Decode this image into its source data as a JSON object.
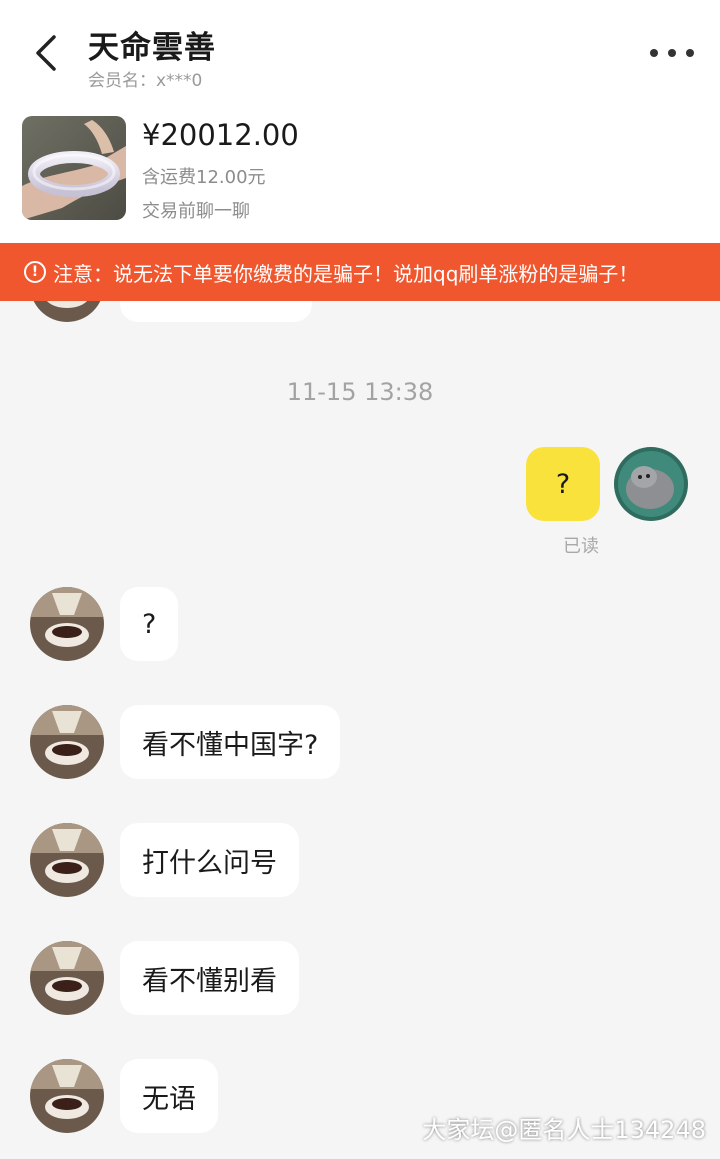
{
  "header": {
    "title": "天命雲善",
    "member_label": "会员名：x***0",
    "back_icon": "chevron-left-icon",
    "more_icon": "more-dots-icon"
  },
  "product": {
    "price": "¥20012.00",
    "shipping": "含运费12.00元",
    "chat_link": "交易前聊一聊"
  },
  "warning": {
    "text": "注意：说无法下单要你缴费的是骗子！说加qq刷单涨粉的是骗子！",
    "background": "#f0572e"
  },
  "chat": {
    "timestamp": "11-15 13:38",
    "sent_message": "?",
    "read_status": "已读",
    "received_messages": [
      "?",
      "看不懂中国字?",
      "打什么问号",
      "看不懂别看",
      "无语"
    ]
  },
  "colors": {
    "my_bubble": "#f9e23c",
    "their_bubble": "#ffffff",
    "page_bg": "#f5f5f5"
  },
  "watermark": "大家坛@匿名人士134248"
}
